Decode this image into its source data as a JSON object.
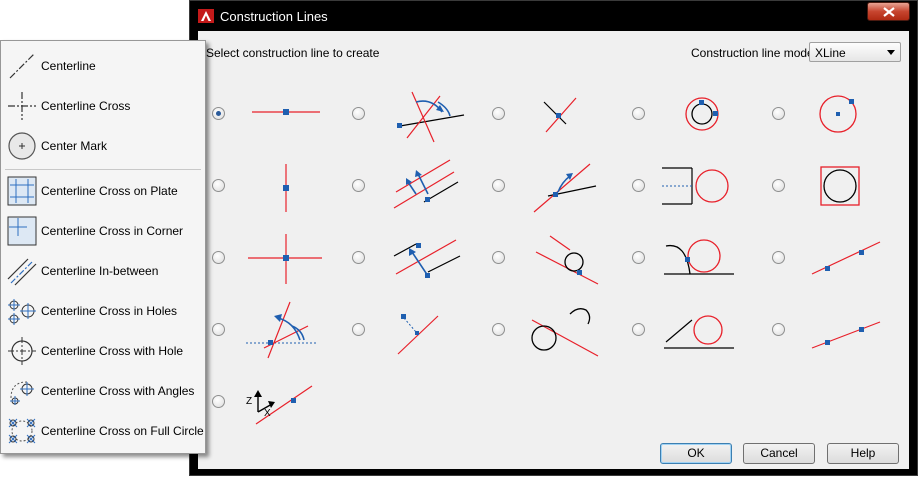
{
  "dialog": {
    "title": "Construction Lines",
    "prompt": "Select construction line to create",
    "mode_label": "Construction line mode:",
    "mode_value": "XLine",
    "options": [
      {
        "id": 1,
        "selected": true
      },
      {
        "id": 2,
        "selected": false
      },
      {
        "id": 3,
        "selected": false
      },
      {
        "id": 4,
        "selected": false
      },
      {
        "id": 5,
        "selected": false
      },
      {
        "id": 6,
        "selected": false
      },
      {
        "id": 7,
        "selected": false
      },
      {
        "id": 8,
        "selected": false
      },
      {
        "id": 9,
        "selected": false
      },
      {
        "id": 10,
        "selected": false
      },
      {
        "id": 11,
        "selected": false
      },
      {
        "id": 12,
        "selected": false
      },
      {
        "id": 13,
        "selected": false
      },
      {
        "id": 14,
        "selected": false
      },
      {
        "id": 15,
        "selected": false
      },
      {
        "id": 16,
        "selected": false
      },
      {
        "id": 17,
        "selected": false
      },
      {
        "id": 18,
        "selected": false
      },
      {
        "id": 19,
        "selected": false
      },
      {
        "id": 20,
        "selected": false
      },
      {
        "id": 21,
        "selected": false
      }
    ],
    "axis_labels": {
      "z": "Z",
      "x": "X"
    },
    "buttons": {
      "ok": "OK",
      "cancel": "Cancel",
      "help": "Help"
    }
  },
  "menu": {
    "items": [
      {
        "label": "Centerline",
        "icon": "centerline-icon"
      },
      {
        "label": "Centerline Cross",
        "icon": "centerline-cross-icon"
      },
      {
        "label": "Center Mark",
        "icon": "center-mark-icon"
      },
      {
        "label": "Centerline Cross on Plate",
        "icon": "cross-on-plate-icon"
      },
      {
        "label": "Centerline Cross in Corner",
        "icon": "cross-in-corner-icon"
      },
      {
        "label": "Centerline In-between",
        "icon": "in-between-icon"
      },
      {
        "label": "Centerline Cross in Holes",
        "icon": "cross-in-holes-icon"
      },
      {
        "label": "Centerline Cross with Hole",
        "icon": "cross-with-hole-icon"
      },
      {
        "label": "Centerline Cross with Angles",
        "icon": "cross-with-angles-icon"
      },
      {
        "label": "Centerline Cross on Full Circle",
        "icon": "cross-on-full-circle-icon"
      }
    ]
  },
  "colors": {
    "red_line": "#e8202a",
    "grip_blue": "#1f5fb0",
    "dialog_bg": "#f0f0f0",
    "titlebar": "#000000"
  }
}
